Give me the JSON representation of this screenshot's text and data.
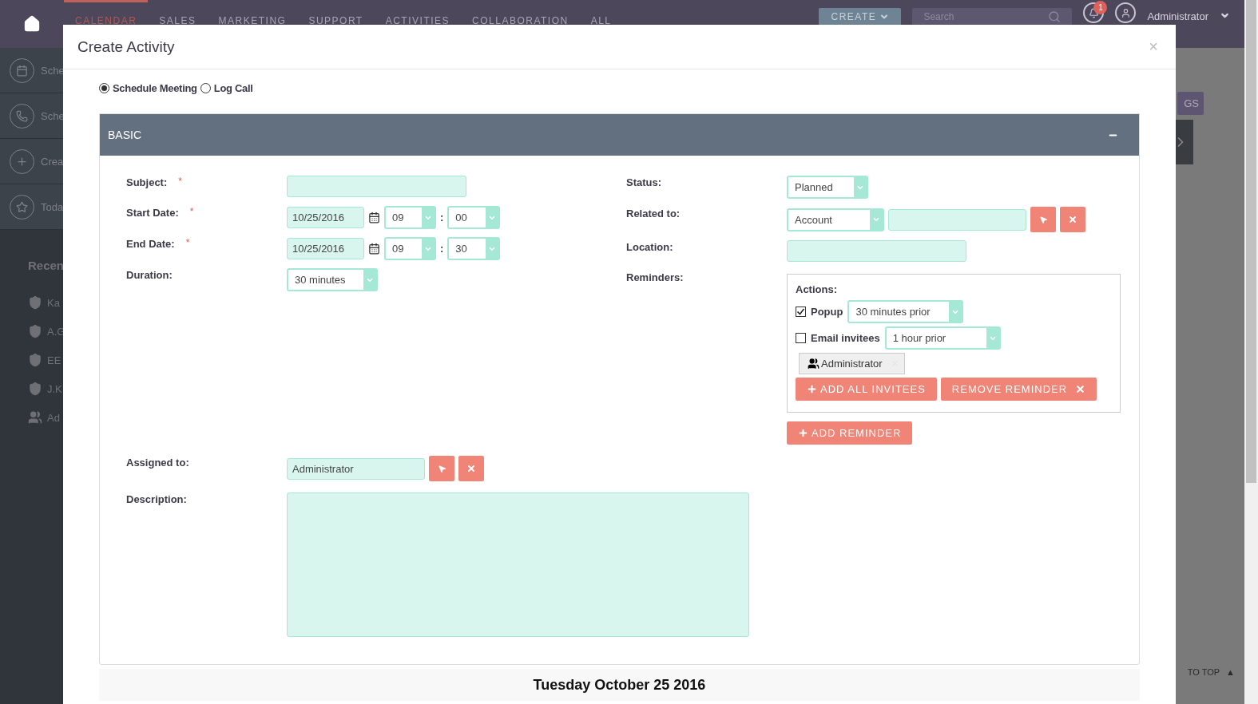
{
  "nav": {
    "items": [
      {
        "label": "CALENDAR",
        "selected": true
      },
      {
        "label": "SALES",
        "selected": false
      },
      {
        "label": "MARKETING",
        "selected": false
      },
      {
        "label": "SUPPORT",
        "selected": false
      },
      {
        "label": "ACTIVITIES",
        "selected": false
      },
      {
        "label": "COLLABORATION",
        "selected": false
      },
      {
        "label": "ALL",
        "selected": false
      }
    ],
    "create_button": "CREATE",
    "search": {
      "placeholder": "Search"
    },
    "notification_count": "1",
    "user": "Administrator"
  },
  "sidebar": {
    "actions": [
      {
        "kind": "calendar",
        "label": "Sche"
      },
      {
        "kind": "phone",
        "label": "Sche"
      },
      {
        "kind": "plus",
        "label": "Crea"
      },
      {
        "kind": "star",
        "label": "Toda"
      }
    ],
    "recent_title": "Recen",
    "recent": [
      {
        "kind": "account",
        "label": "Ka"
      },
      {
        "kind": "account",
        "label": "A.G"
      },
      {
        "kind": "account",
        "label": "EE"
      },
      {
        "kind": "account",
        "label": "J.K"
      },
      {
        "kind": "user",
        "label": "Ad"
      }
    ]
  },
  "background": {
    "settings_button": "GS",
    "back_to_top": "TO TOP",
    "back_to_top_arrow": "▲"
  },
  "modal": {
    "title": "Create Activity",
    "close": "×",
    "types": [
      {
        "label": "Schedule Meeting",
        "selected": true
      },
      {
        "label": "Log Call",
        "selected": false
      }
    ],
    "panel": {
      "title": "BASIC",
      "expanded": true
    },
    "time_separator": ":",
    "required_mark": "*",
    "left_fields": [
      {
        "kind": "text",
        "label": "Subject:",
        "required": true
      },
      {
        "kind": "datetime",
        "label": "Start Date:",
        "required": true,
        "date": "10/25/2016",
        "hour": "09",
        "minute": "00"
      },
      {
        "kind": "datetime",
        "label": "End Date:",
        "required": true,
        "date": "10/25/2016",
        "hour": "09",
        "minute": "30"
      },
      {
        "kind": "select",
        "label": "Duration:",
        "required": false,
        "value": "30 minutes"
      }
    ],
    "right_fields": [
      {
        "kind": "select",
        "label": "Status:",
        "required": false,
        "value": "Planned"
      },
      {
        "kind": "relate",
        "label": "Related to:",
        "required": false,
        "value": "Account"
      },
      {
        "kind": "text",
        "label": "Location:",
        "required": false
      },
      {
        "kind": "reminders",
        "label": "Reminders:",
        "required": false
      }
    ],
    "reminders": {
      "actions_label": "Actions:",
      "options": [
        {
          "label": "Popup",
          "checked": true,
          "value": "30 minutes prior"
        },
        {
          "label": "Email invitees",
          "checked": false,
          "value": "1 hour prior"
        }
      ],
      "invitees": [
        "Administrator"
      ],
      "add_all_button": "ADD ALL INVITEES",
      "remove_button": "REMOVE REMINDER",
      "add_reminder_button": "ADD REMINDER"
    },
    "assigned": {
      "label": "Assigned to:",
      "value": "Administrator"
    },
    "description": {
      "label": "Description:"
    },
    "day_header": "Tuesday October 25 2016"
  }
}
